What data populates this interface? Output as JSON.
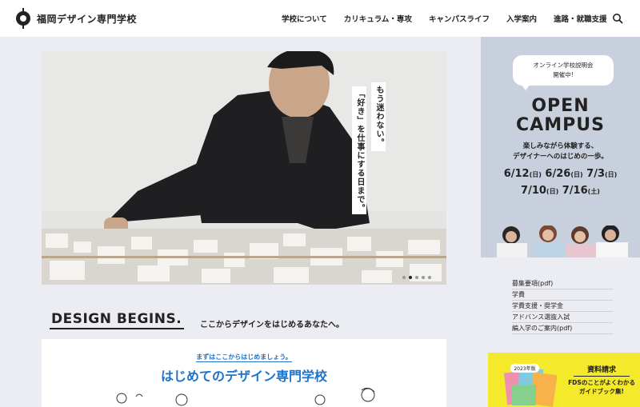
{
  "header": {
    "logo_text": "福岡デザイン専門学校",
    "nav": [
      "学校について",
      "カリキュラム・専攻",
      "キャンパスライフ",
      "入学案内",
      "進路・就職支援"
    ]
  },
  "hero": {
    "copy_1": "もう迷わない。",
    "copy_2": "「好き」を仕事にする日まで。"
  },
  "open_campus": {
    "bubble": "オンライン学校説明会\n開催中!",
    "title": "OPEN\nCAMPUS",
    "subtitle": "楽しみながら体験する、\nデザイナーへのはじめの一歩。",
    "dates_line1": [
      {
        "date": "6/12",
        "day": "(日)"
      },
      {
        "date": "6/26",
        "day": "(日)"
      },
      {
        "date": "7/3",
        "day": "(日)"
      }
    ],
    "dates_line2": [
      {
        "date": "7/10",
        "day": "(日)"
      },
      {
        "date": "7/16",
        "day": "(土)"
      }
    ]
  },
  "links": [
    "募集要項(pdf)",
    "学費",
    "学費支援・奨学金",
    "アドバンス選抜入試",
    "編入学のご案内(pdf)"
  ],
  "request": {
    "title": "資料請求",
    "desc": "FDSのことがよくわかる\nガイドブック集!",
    "badge": "2023年版"
  },
  "intro": {
    "heading": "DESIGN BEGINS.",
    "sub": "ここからデザインをはじめるあなたへ。"
  },
  "card": {
    "lead": "まずはここからはじめましょう。",
    "title": "はじめてのデザイン専門学校"
  },
  "colors": {
    "accent_blue": "#1e73c8",
    "request_yellow": "#f5e92c",
    "campus_bg": "#c9d0dd"
  }
}
